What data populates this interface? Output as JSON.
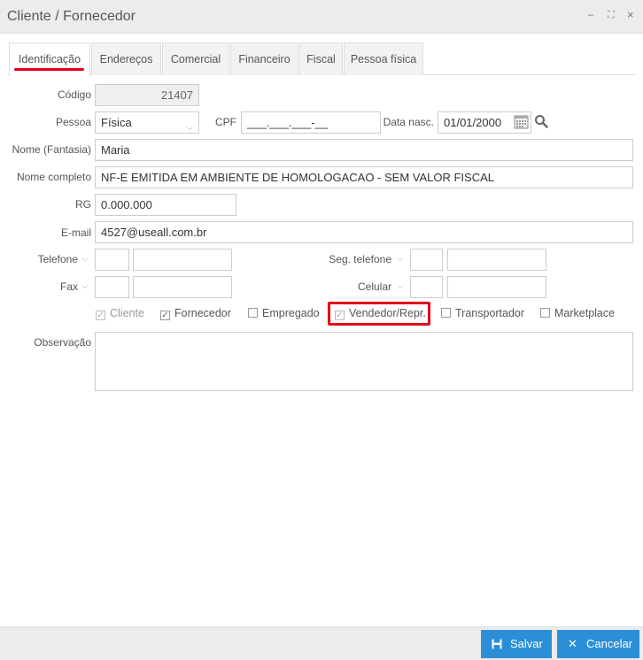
{
  "window": {
    "title": "Cliente / Fornecedor",
    "minimize_glyph": "–",
    "maximize_glyph": "⛶",
    "close_glyph": "×"
  },
  "tabs": [
    {
      "label": "Identificação",
      "active": true
    },
    {
      "label": "Endereços"
    },
    {
      "label": "Comercial"
    },
    {
      "label": "Financeiro"
    },
    {
      "label": "Fiscal"
    },
    {
      "label": "Pessoa física"
    }
  ],
  "form": {
    "codigo": {
      "label": "Código",
      "value": "21407"
    },
    "pessoa": {
      "label": "Pessoa",
      "value": "Física"
    },
    "cpf": {
      "label": "CPF",
      "value": "___.___.___-__"
    },
    "data_nasc": {
      "label": "Data nasc.",
      "value": "01/01/2000"
    },
    "nome_fantasia": {
      "label": "Nome (Fantasia)",
      "value": "Maria"
    },
    "nome_completo": {
      "label": "Nome completo",
      "value": "NF-E EMITIDA EM AMBIENTE DE HOMOLOGACAO - SEM VALOR FISCAL"
    },
    "rg": {
      "label": "RG",
      "value": "0.000.000"
    },
    "email": {
      "label": "E-mail",
      "value": "4527@useall.com.br"
    },
    "telefone": {
      "label": "Telefone"
    },
    "seg_telefone": {
      "label": "Seg. telefone"
    },
    "fax": {
      "label": "Fax"
    },
    "celular": {
      "label": "Celular"
    },
    "observacao": {
      "label": "Observação"
    }
  },
  "checkboxes": [
    {
      "label": "Cliente",
      "checked": true,
      "disabled": true
    },
    {
      "label": "Fornecedor",
      "checked": true
    },
    {
      "label": "Empregado",
      "checked": false
    },
    {
      "label": "Vendedor/Repr.",
      "checked": true,
      "disabled": true
    },
    {
      "label": "Transportador",
      "checked": false
    },
    {
      "label": "Marketplace",
      "checked": false
    }
  ],
  "icons": {
    "calendar": "calendar-icon",
    "search": "search-icon",
    "save": "save-icon",
    "cancel": "close-icon"
  },
  "colors": {
    "primary_button": "#2b8fd8",
    "highlight_red": "#e1001a"
  },
  "footer": {
    "save_label": "Salvar",
    "cancel_label": "Cancelar",
    "save_glyph": "💾",
    "cancel_glyph": "✕"
  }
}
